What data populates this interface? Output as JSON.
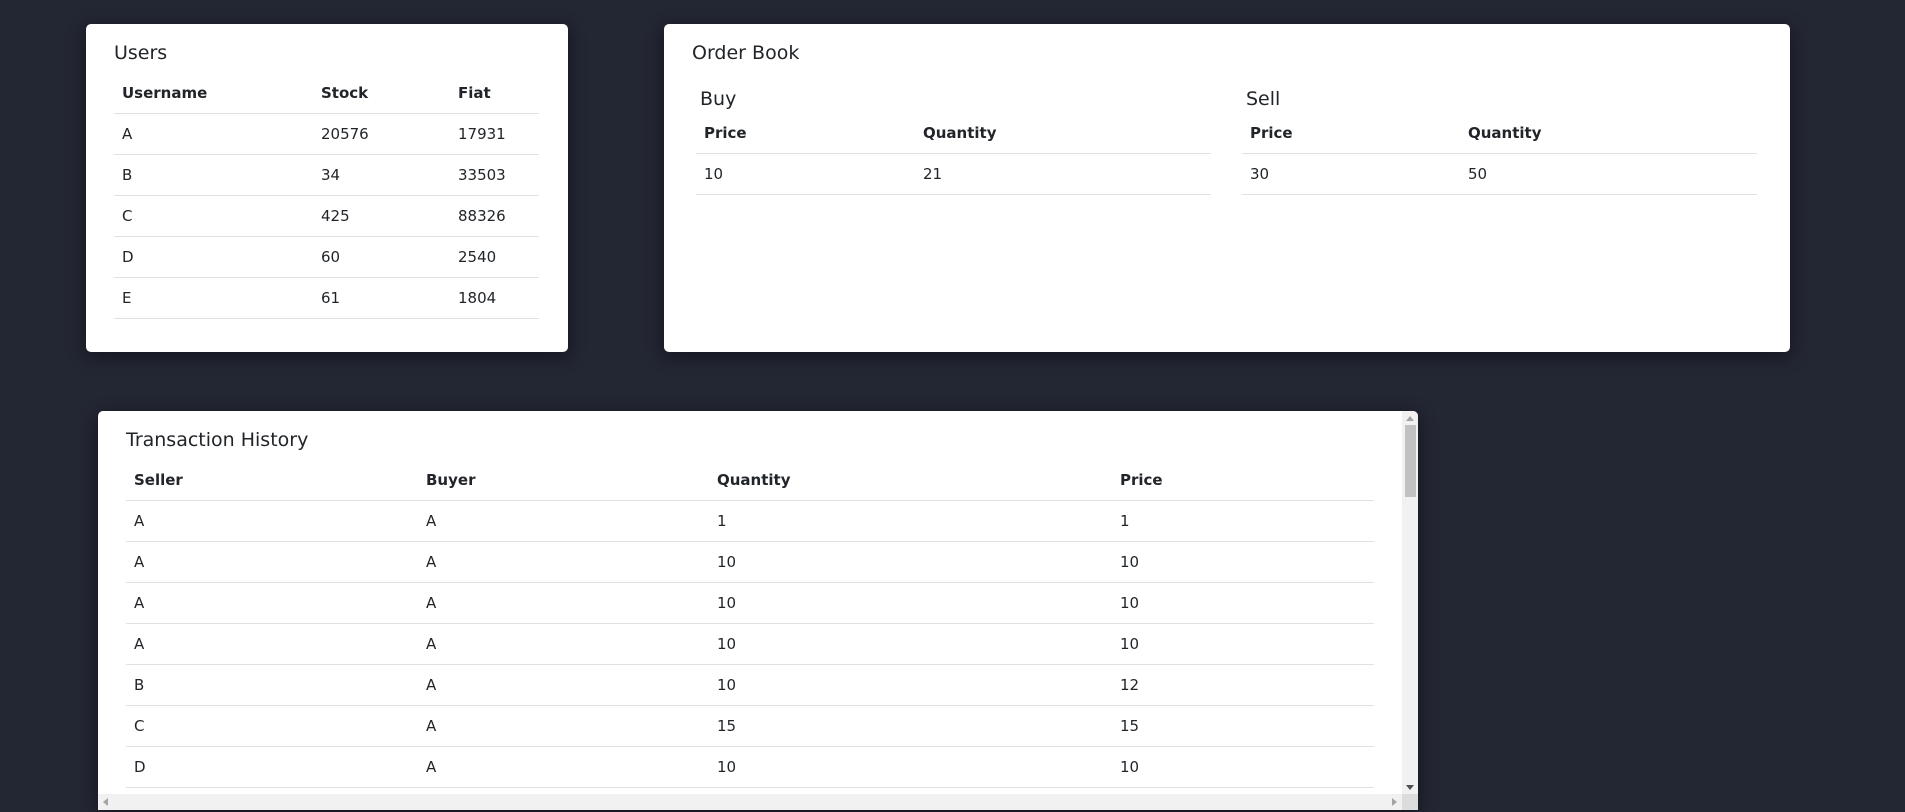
{
  "users": {
    "title": "Users",
    "columns": [
      "Username",
      "Stock",
      "Fiat"
    ],
    "rows": [
      [
        "A",
        "20576",
        "17931"
      ],
      [
        "B",
        "34",
        "33503"
      ],
      [
        "C",
        "425",
        "88326"
      ],
      [
        "D",
        "60",
        "2540"
      ],
      [
        "E",
        "61",
        "1804"
      ]
    ]
  },
  "order_book": {
    "title": "Order Book",
    "buy": {
      "title": "Buy",
      "columns": [
        "Price",
        "Quantity"
      ],
      "rows": [
        [
          "10",
          "21"
        ]
      ]
    },
    "sell": {
      "title": "Sell",
      "columns": [
        "Price",
        "Quantity"
      ],
      "rows": [
        [
          "30",
          "50"
        ]
      ]
    }
  },
  "history": {
    "title": "Transaction History",
    "columns": [
      "Seller",
      "Buyer",
      "Quantity",
      "Price"
    ],
    "rows": [
      [
        "A",
        "A",
        "1",
        "1"
      ],
      [
        "A",
        "A",
        "10",
        "10"
      ],
      [
        "A",
        "A",
        "10",
        "10"
      ],
      [
        "A",
        "A",
        "10",
        "10"
      ],
      [
        "B",
        "A",
        "10",
        "12"
      ],
      [
        "C",
        "A",
        "15",
        "15"
      ],
      [
        "D",
        "A",
        "10",
        "10"
      ]
    ]
  },
  "icons": {
    "scroll_up": "scroll-up-arrow-icon",
    "scroll_down": "scroll-down-arrow-icon",
    "scroll_left": "scroll-left-arrow-icon",
    "scroll_right": "scroll-right-arrow-icon"
  },
  "colors": {
    "background": "#232633",
    "card": "#ffffff"
  }
}
